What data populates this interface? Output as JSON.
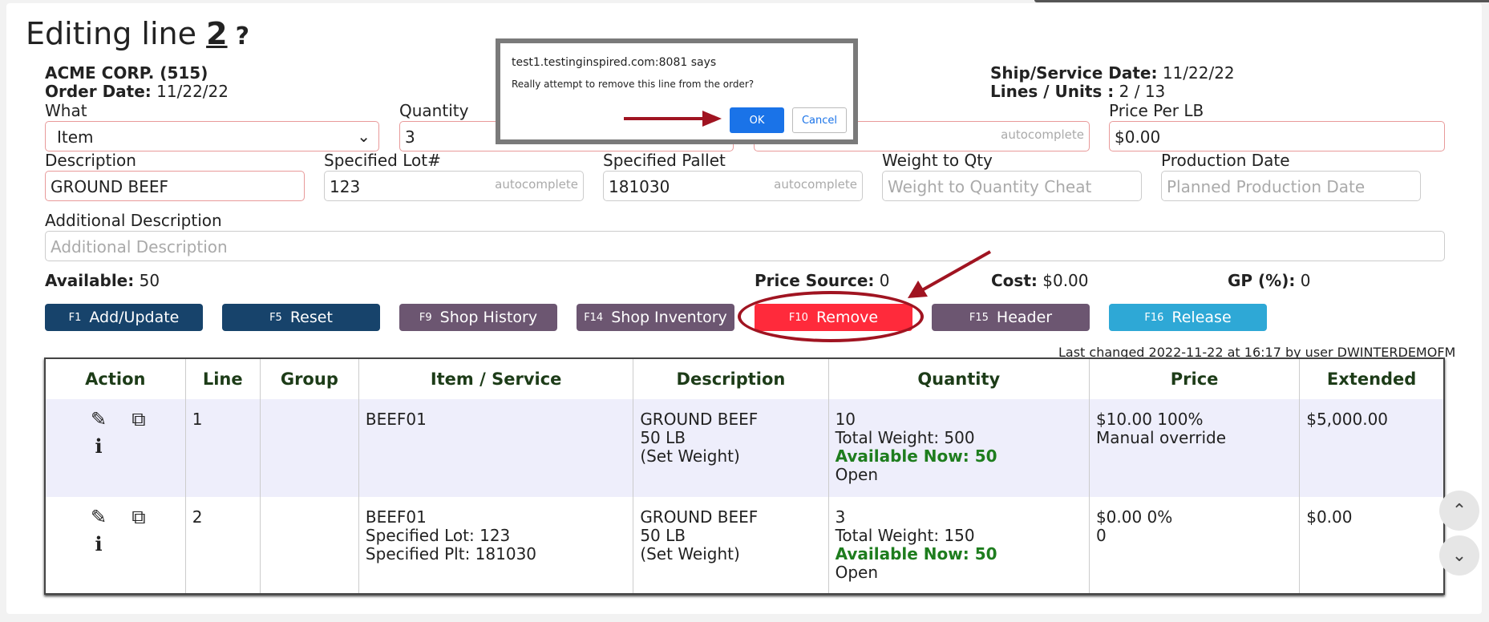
{
  "title": {
    "prefix": "Editing line",
    "number": "2",
    "help": "?"
  },
  "customer": "ACME CORP. (515)",
  "order_date_label": "Order Date:",
  "order_date": "11/22/22",
  "ship_date_label": "Ship/Service Date:",
  "ship_date": "11/22/22",
  "lines_units_label": "Lines / Units :",
  "lines_units": "2 / 13",
  "form": {
    "what_label": "What",
    "what_value": "Item",
    "quantity_label": "Quantity",
    "quantity_value": "3",
    "item_autocomplete": "autocomplete",
    "price_label": "Price Per LB",
    "price_value": "$0.00",
    "description_label": "Description",
    "description_value": "GROUND BEEF",
    "lot_label": "Specified Lot#",
    "lot_value": "123",
    "lot_autocomplete": "autocomplete",
    "pallet_label": "Specified Pallet",
    "pallet_value": "181030",
    "pallet_autocomplete": "autocomplete",
    "weight_label": "Weight to Qty",
    "weight_placeholder": "Weight to Quantity Cheat",
    "production_label": "Production Date",
    "production_placeholder": "Planned Production Date",
    "additional_label": "Additional Description",
    "additional_placeholder": "Additional Description"
  },
  "stats": {
    "available_label": "Available:",
    "available_value": "50",
    "price_source_label": "Price Source:",
    "price_source_value": "0",
    "cost_label": "Cost:",
    "cost_value": "$0.00",
    "gp_label": "GP (%):",
    "gp_value": "0"
  },
  "buttons": [
    {
      "key": "F1",
      "label": "Add/Update"
    },
    {
      "key": "F5",
      "label": "Reset"
    },
    {
      "key": "F9",
      "label": "Shop History"
    },
    {
      "key": "F14",
      "label": "Shop Inventory"
    },
    {
      "key": "F10",
      "label": "Remove"
    },
    {
      "key": "F15",
      "label": "Header"
    },
    {
      "key": "F16",
      "label": "Release"
    }
  ],
  "last_changed": "Last changed 2022-11-22 at 16:17 by user DWINTERDEMOFM",
  "table": {
    "headers": [
      "Action",
      "Line",
      "Group",
      "Item / Service",
      "Description",
      "Quantity",
      "Price",
      "Extended"
    ],
    "rows": [
      {
        "line": "1",
        "group": "",
        "item": [
          "BEEF01"
        ],
        "description": [
          "GROUND BEEF",
          "50 LB",
          "(Set Weight)"
        ],
        "qty": "10",
        "total_weight": "Total Weight: 500",
        "available": "Available Now: 50",
        "status": "Open",
        "price": [
          "$10.00 100%",
          "Manual override"
        ],
        "extended": "$5,000.00"
      },
      {
        "line": "2",
        "group": "",
        "item": [
          "BEEF01",
          "Specified Lot: 123",
          "Specified Plt: 181030"
        ],
        "description": [
          "GROUND BEEF",
          "50 LB",
          "(Set Weight)"
        ],
        "qty": "3",
        "total_weight": "Total Weight: 150",
        "available": "Available Now: 50",
        "status": "Open",
        "price": [
          "$0.00 0%",
          "0"
        ],
        "extended": "$0.00"
      }
    ]
  },
  "dialog": {
    "origin": "test1.testinginspired.com:8081 says",
    "message": "Really attempt to remove this line from the order?",
    "ok": "OK",
    "cancel": "Cancel"
  },
  "colors": {
    "primary_button": "#17436b",
    "secondary_button": "#6c5671",
    "remove_button": "#ff2a3b",
    "release_button": "#2ea8d6",
    "annotation": "#a01421",
    "available_text": "#1e7d1e"
  }
}
